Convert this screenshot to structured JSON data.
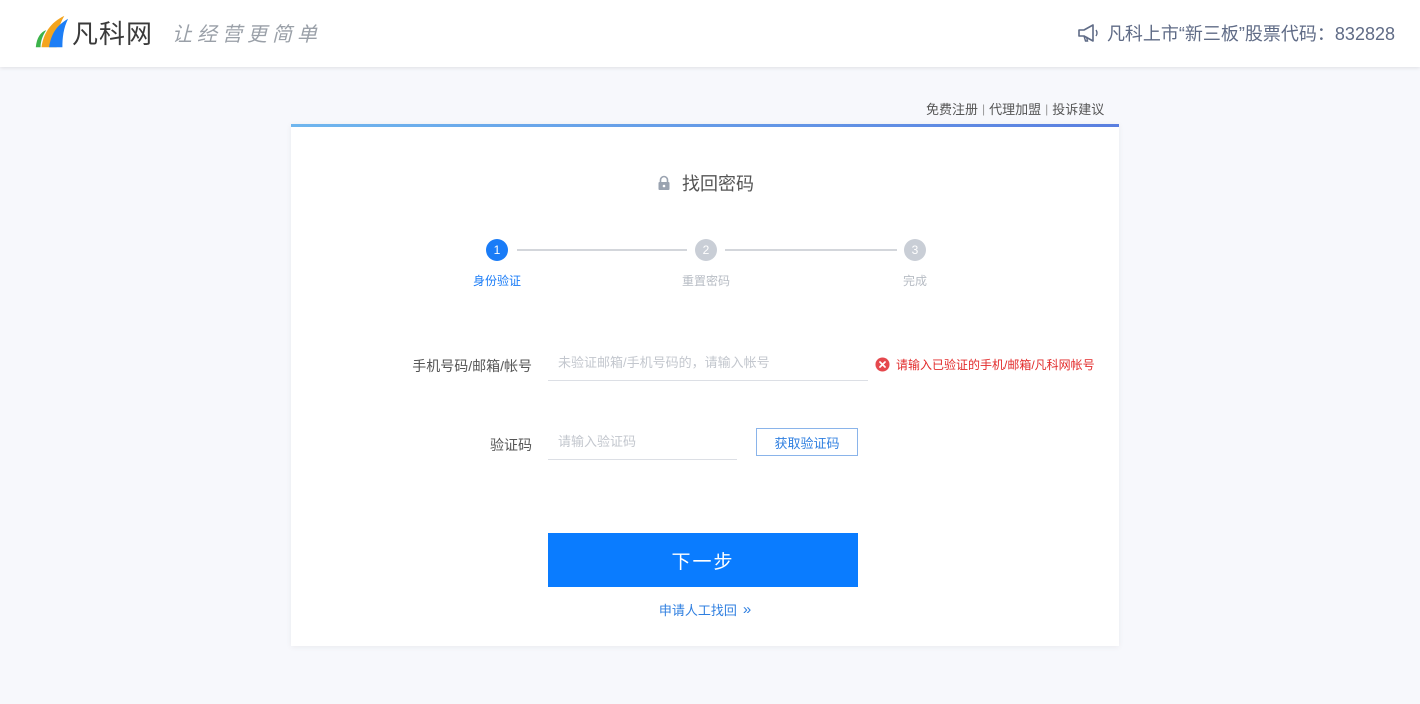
{
  "header": {
    "logo_text": "凡科网",
    "slogan": "让经营更简单",
    "notice_text": "凡科上市“新三板”股票代码：832828"
  },
  "top_links": [
    "免费注册",
    "代理加盟",
    "投诉建议"
  ],
  "top_links_separator": "|",
  "card": {
    "title": "找回密码",
    "steps": [
      {
        "number": "1",
        "label": "身份验证",
        "state": "active"
      },
      {
        "number": "2",
        "label": "重置密码",
        "state": "inactive"
      },
      {
        "number": "3",
        "label": "完成",
        "state": "inactive"
      }
    ],
    "account_field": {
      "label": "手机号码/邮箱/帐号",
      "placeholder": "未验证邮箱/手机号码的，请输入帐号",
      "value": "",
      "error": "请输入已验证的手机/邮箱/凡科网帐号"
    },
    "code_field": {
      "label": "验证码",
      "placeholder": "请输入验证码",
      "value": "",
      "button_label": "获取验证码"
    },
    "next_button": "下一步",
    "manual_link": "申请人工找回",
    "manual_link_arrow": "»"
  },
  "colors": {
    "primary": "#0a7cff",
    "step_active": "#1a7cf7",
    "step_inactive": "#c9ced6",
    "error": "#e22b2b",
    "background": "#f7f8fc"
  },
  "icons": {
    "logo": "fanke-logo-icon",
    "notice": "megaphone-icon",
    "title": "lock-icon",
    "error": "error-circle-icon"
  }
}
